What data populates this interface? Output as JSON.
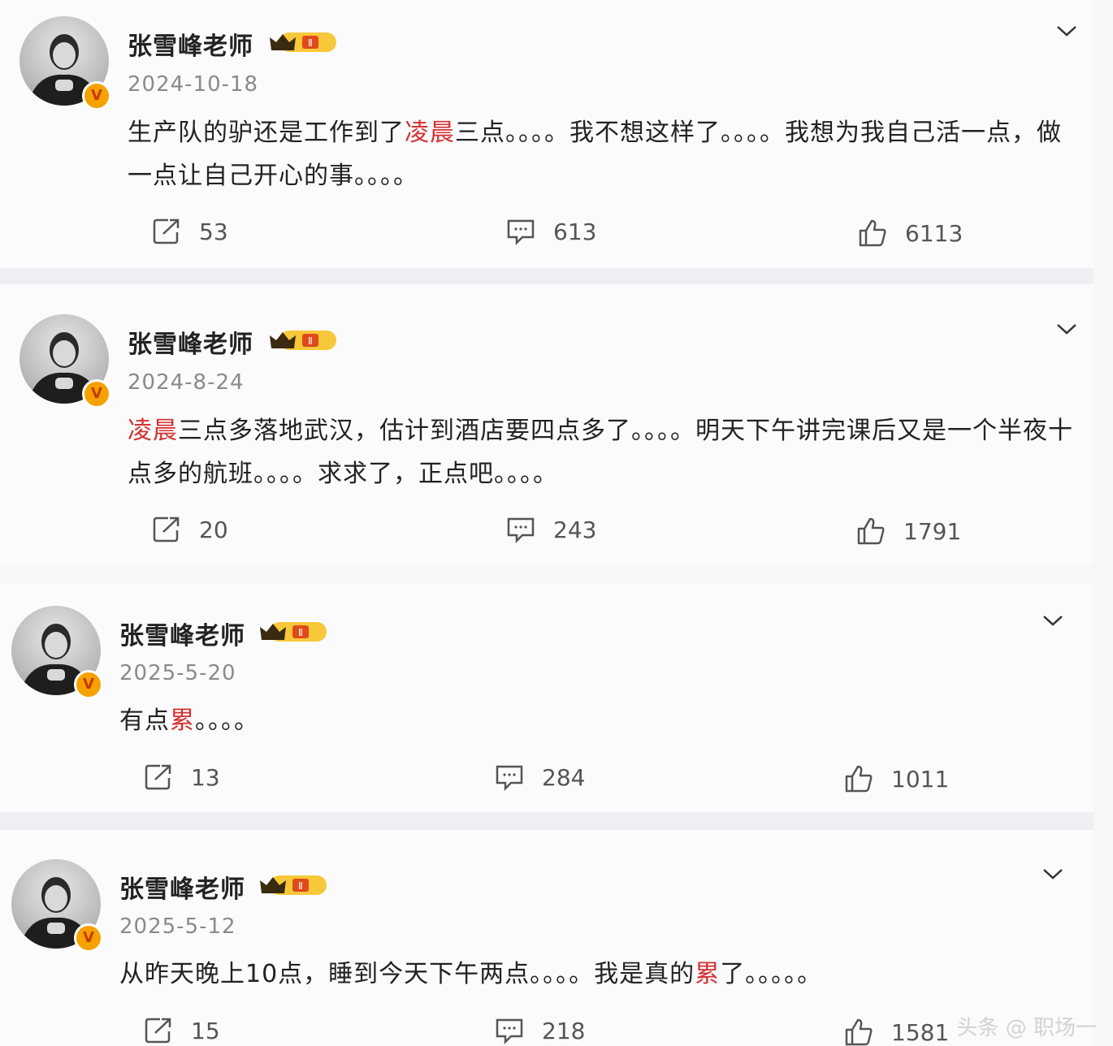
{
  "posts": [
    {
      "author": "张雪峰老师",
      "date": "2024-10-18",
      "content_parts": [
        "生产队的驴还是工作到了",
        "凌晨",
        "三点。。。。我不想这样了。。。。我想为我自己活一点，做一点让自己开心的事。。。。"
      ],
      "reposts": "53",
      "comments": "613",
      "likes": "6113"
    },
    {
      "author": "张雪峰老师",
      "date": "2024-8-24",
      "content_parts": [
        "",
        "凌晨",
        "三点多落地武汉，估计到酒店要四点多了。。。。明天下午讲完课后又是一个半夜十点多的航班。。。。求求了，正点吧。。。。"
      ],
      "reposts": "20",
      "comments": "243",
      "likes": "1791"
    },
    {
      "author": "张雪峰老师",
      "date": "2025-5-20",
      "content_parts": [
        "有点",
        "累",
        "。。。。"
      ],
      "reposts": "13",
      "comments": "284",
      "likes": "1011"
    },
    {
      "author": "张雪峰老师",
      "date": "2025-5-12",
      "content_parts": [
        "从昨天晚上10点，睡到今天下午两点。。。。我是真的",
        "累",
        "了。。。。。"
      ],
      "reposts": "15",
      "comments": "218",
      "likes": "1581"
    }
  ],
  "icons": {
    "repost": "repost-icon",
    "comment": "comment-icon",
    "like": "like-icon",
    "more": "chevron-down-icon",
    "verified": "verified-badge-icon",
    "vip": "vip-crown-icon"
  },
  "colors": {
    "highlight": "#d43030",
    "verified": "#f5a100",
    "background": "#fbfbfd"
  },
  "watermark": "头条 @ 职场一"
}
